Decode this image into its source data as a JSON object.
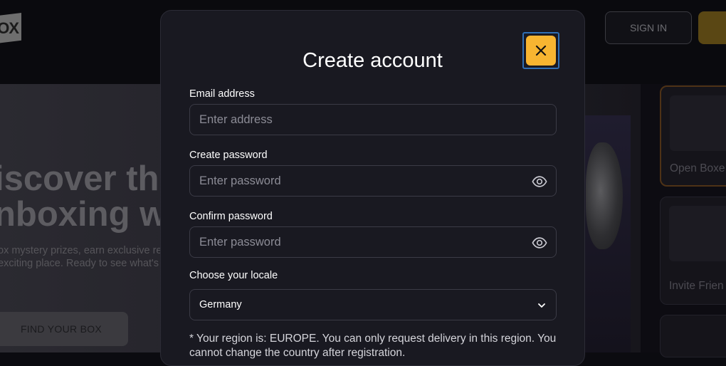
{
  "background": {
    "logo_text": "OX",
    "signin_label": "SIGN IN",
    "hero_title_line1": "iscover the",
    "hero_title_line2": "nboxing w",
    "hero_sub_line1": "ox mystery prizes, earn exclusive rew",
    "hero_sub_line2": "exciting place. Ready to see what's in",
    "find_box_label": "FIND YOUR BOX",
    "side_cards": [
      {
        "label": "Open Boxe"
      },
      {
        "label": "Invite Frien"
      }
    ]
  },
  "modal": {
    "title": "Create account",
    "close_icon": "close-icon",
    "email": {
      "label": "Email address",
      "placeholder": "Enter address",
      "value": ""
    },
    "password": {
      "label": "Create password",
      "placeholder": "Enter password",
      "value": ""
    },
    "confirm": {
      "label": "Confirm password",
      "placeholder": "Enter password",
      "value": ""
    },
    "locale": {
      "label": "Choose your locale",
      "selected": "Germany"
    },
    "region_note": "* Your region is: EUROPE. You can only request delivery in this region. You cannot change the country after registration."
  },
  "colors": {
    "accent": "#f7b531",
    "modal_bg": "#191921",
    "focus_ring": "#2f6fb5"
  }
}
